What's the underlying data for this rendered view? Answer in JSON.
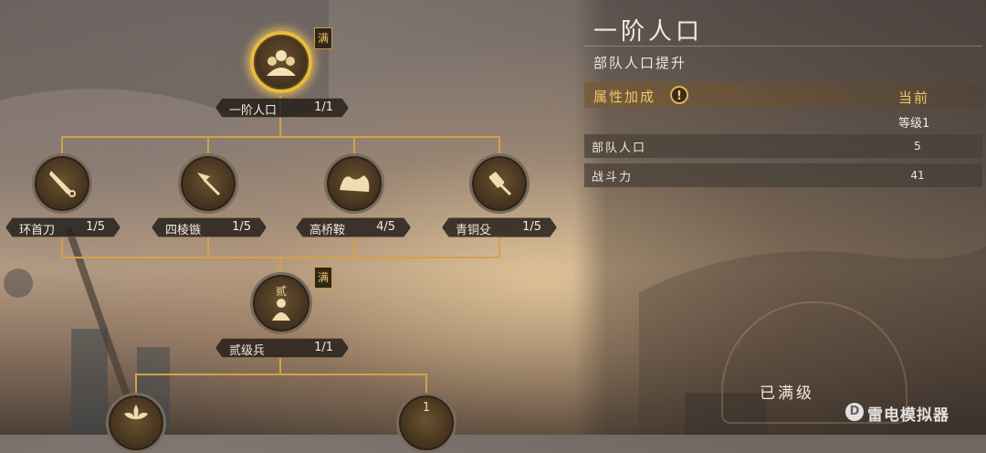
{
  "panel": {
    "title": "一阶人口",
    "subtitle": "部队人口提升",
    "attr_header": "属性加成",
    "warn_glyph": "!",
    "current_header": "当前",
    "level_label": "等级1",
    "rows": [
      {
        "label": "部队人口",
        "value": "5"
      },
      {
        "label": "战斗力",
        "value": "41"
      }
    ],
    "maxed_label": "已满级"
  },
  "tree": {
    "top": {
      "name": "一阶人口",
      "progress": "1/1",
      "badge": "满",
      "icon": "population-icon"
    },
    "mid": [
      {
        "name": "环首刀",
        "progress": "1/5",
        "icon": "blade-icon"
      },
      {
        "name": "四棱镞",
        "progress": "1/5",
        "icon": "arrowhead-icon"
      },
      {
        "name": "高桥鞍",
        "progress": "4/5",
        "icon": "saddle-icon"
      },
      {
        "name": "青铜殳",
        "progress": "1/5",
        "icon": "mace-icon"
      }
    ],
    "tier2": {
      "name": "贰级兵",
      "progress": "1/1",
      "badge": "满",
      "icon_text": "贰",
      "icon": "soldier-icon"
    },
    "bottom_partial": [
      {
        "icon": "lotus-icon"
      },
      {
        "icon_text": "1",
        "icon": "tier-one-icon"
      }
    ]
  },
  "watermark": {
    "text": "雷电模拟器",
    "logo_glyph": "D"
  }
}
